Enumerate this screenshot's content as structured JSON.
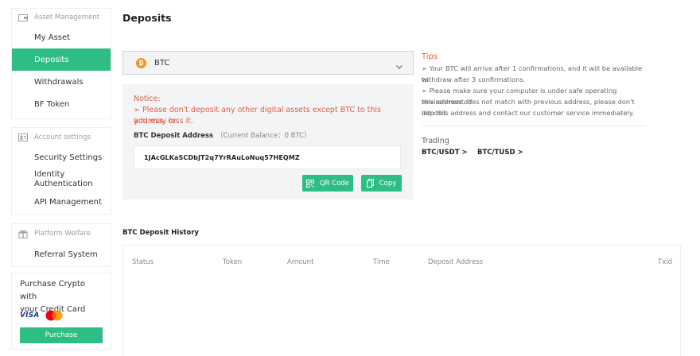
{
  "sidebar": {
    "asset_management": {
      "header": "Asset Management",
      "items": [
        {
          "label": "My Asset"
        },
        {
          "label": "Deposits",
          "active": true
        },
        {
          "label": "Withdrawals"
        },
        {
          "label": "BF Token"
        }
      ]
    },
    "account_settings": {
      "header": "Account settings",
      "items": [
        {
          "label": "Security Settings"
        },
        {
          "label_line1": "Identity",
          "label_line2": "Authentication"
        },
        {
          "label": "API Management"
        }
      ]
    },
    "platform_welfare": {
      "header": "Platform Welfare",
      "items": [
        {
          "label": "Referral System"
        }
      ]
    },
    "promo": {
      "line1": "Purchase Crypto with",
      "line2": "your Credit Card",
      "visa": "VISA",
      "purchase_label": "Purchase"
    }
  },
  "main": {
    "title": "Deposits",
    "coin_select": {
      "icon": "bitcoin-icon",
      "value": "BTC"
    },
    "notice": {
      "title": "Notice:",
      "line1": "➢ Please don't deposit any other digital assets except BTC to this address, or",
      "line2": "you may loss it."
    },
    "address_label": "BTC Deposit Address",
    "balance_text": "（Current Balance：0 BTC）",
    "address": "1JAcGLKaSCDbJT2q7YrRAuLoNuq57HEQMZ",
    "qr_label": "QR Code",
    "copy_label": "Copy"
  },
  "tips": {
    "title": "Tips",
    "tip1_line1": "➢ Your BTC will arrive after 1 confirmations, and it will be available to",
    "tip1_line2": "withdraw after 3 confirmations.",
    "tip2_line1": "➢ Please make sure your computer is under safe operating environment. If",
    "tip2_line2": "this address does not match with previous address, please don't deposit",
    "tip2_line3": "into this address and contact our customer service immediately.",
    "trading_title": "Trading",
    "trading_links": [
      {
        "label": "BTC/USDT >"
      },
      {
        "label": "BTC/TUSD >"
      }
    ]
  },
  "history": {
    "title": "BTC Deposit History",
    "columns": [
      "Status",
      "Token",
      "Amount",
      "Time",
      "Deposit Address",
      "Txid"
    ]
  },
  "colors": {
    "accent": "#2ebd85",
    "notice_red": "#de5f4a",
    "bitcoin_orange": "#f7931a"
  }
}
